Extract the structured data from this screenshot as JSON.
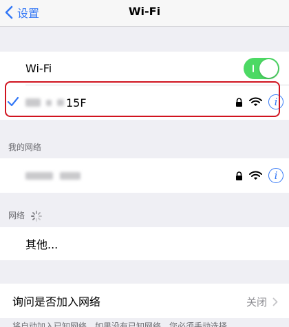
{
  "nav": {
    "back_label": "设置",
    "title": "Wi-Fi"
  },
  "wifi_toggle": {
    "label": "Wi-Fi",
    "state": "on",
    "color": "#4cd964"
  },
  "connected_network": {
    "ssid_visible_suffix": "15F",
    "secured": true,
    "selected": true
  },
  "my_networks": {
    "header": "我的网络",
    "items": [
      {
        "secured": true
      }
    ]
  },
  "networks": {
    "header": "网络",
    "other_label": "其他..."
  },
  "ask_to_join": {
    "label": "询问是否加入网络",
    "value": "关闭"
  },
  "footer_text": "将自动加入已知网络。如果没有已知网络，您必须手动选择",
  "colors": {
    "accent": "#3478f6",
    "highlight": "#d0131f",
    "toggle_on": "#4cd964"
  },
  "icons": [
    "chevron-left-icon",
    "checkmark-icon",
    "lock-icon",
    "wifi-icon",
    "info-icon",
    "spinner-icon",
    "chevron-right-icon"
  ]
}
